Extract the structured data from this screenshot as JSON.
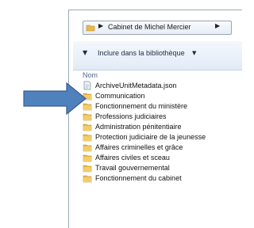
{
  "address_bar": {
    "path": "Cabinet de Michel Mercier",
    "icon": "folder-icon"
  },
  "toolbar": {
    "include_label": "Inclure dans la bibliothèque"
  },
  "columns": {
    "name_header": "Nom"
  },
  "files": [
    {
      "name": "ArchiveUnitMetadata.json",
      "icon": "json-file-icon"
    },
    {
      "name": "Communication",
      "icon": "folder-icon"
    },
    {
      "name": "Fonctionnement du ministère",
      "icon": "folder-icon"
    },
    {
      "name": "Professions judiciaires",
      "icon": "folder-icon"
    },
    {
      "name": "Administration pénitentiaire",
      "icon": "folder-icon"
    },
    {
      "name": "Protection judiciaire de la jeunesse",
      "icon": "folder-icon"
    },
    {
      "name": "Affaires criminelles et grâce",
      "icon": "folder-icon"
    },
    {
      "name": "Affaires civiles et sceau",
      "icon": "folder-icon"
    },
    {
      "name": "Travail gouvernemental",
      "icon": "folder-icon"
    },
    {
      "name": "Fonctionnement du cabinet",
      "icon": "folder-icon"
    }
  ],
  "colors": {
    "folder": "#e8b94a",
    "arrow": "#4f81bd",
    "arrow_border": "#385d8a"
  }
}
